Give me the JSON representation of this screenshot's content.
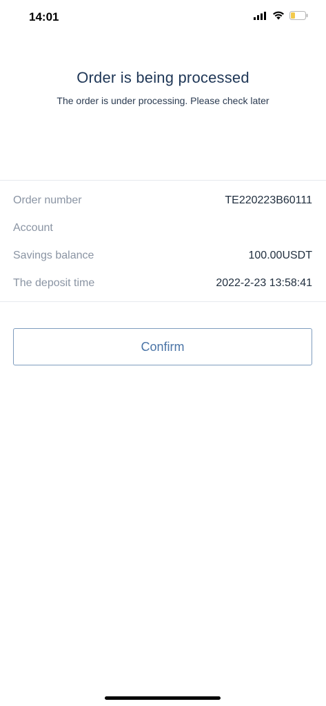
{
  "status_bar": {
    "time": "14:01",
    "icons": [
      "cellular-signal-icon",
      "wifi-icon",
      "battery-icon"
    ],
    "battery_color": "#f2c94c"
  },
  "hero": {
    "title": "Order is being processed",
    "subtitle": "The order is under processing. Please check later"
  },
  "details": {
    "order_number_label": "Order number",
    "order_number_value": "TE220223B60111",
    "account_label": "Account",
    "account_value": "",
    "balance_label": "Savings balance",
    "balance_value": "100.00USDT",
    "deposit_time_label": "The deposit time",
    "deposit_time_value": "2022-2-23 13:58:41"
  },
  "actions": {
    "confirm_label": "Confirm"
  },
  "colors": {
    "title": "#1e3656",
    "accent": "#4a74a6",
    "label": "#8a94a3"
  }
}
